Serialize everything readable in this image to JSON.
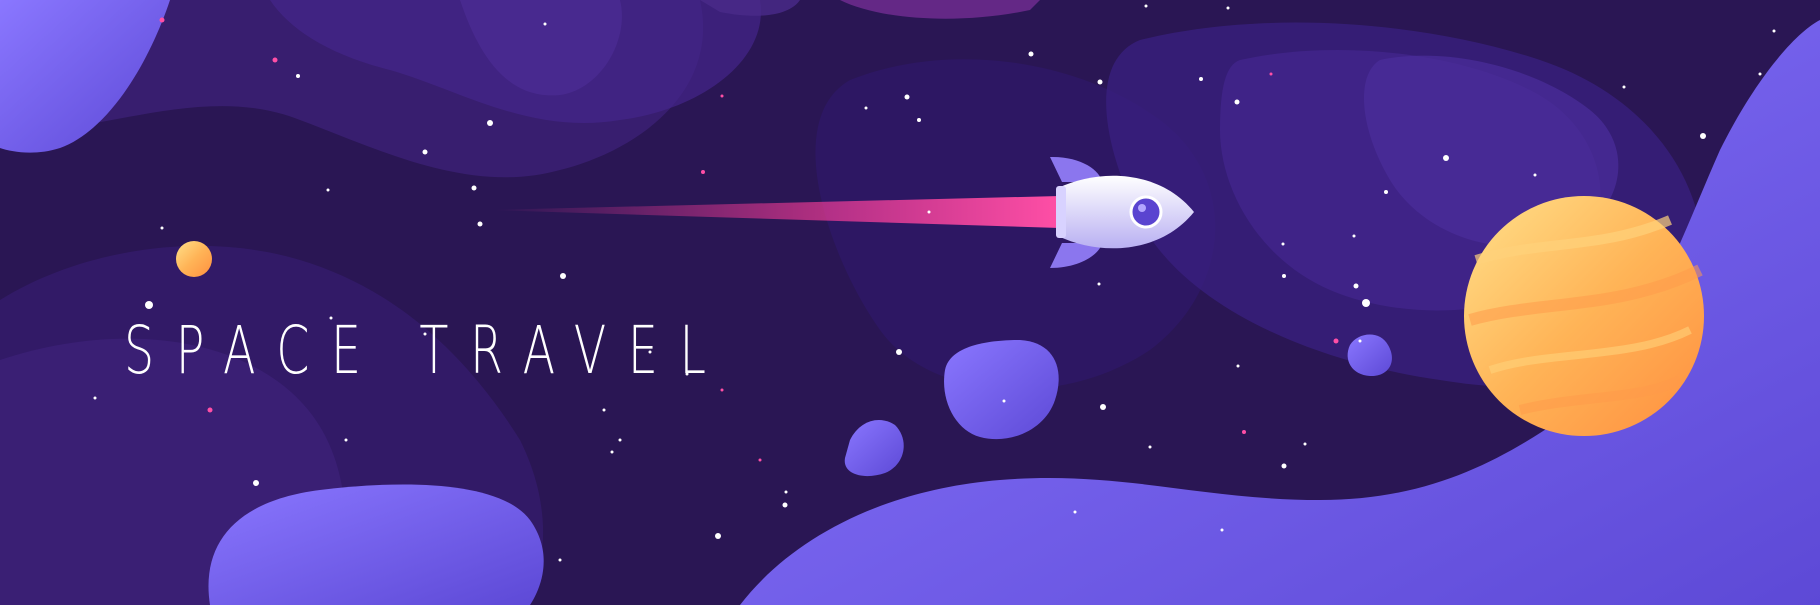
{
  "banner": {
    "title": "SPACE TRAVEL"
  },
  "colors": {
    "background": "#2a1654",
    "nebula_dark": "#231148",
    "nebula_mid": "#3a1f72",
    "foreground_blob": "#7b66f2",
    "planet_orange": "#ffb457",
    "rocket_body": "#e9e5ff",
    "rocket_trail": "#ff3d9a"
  }
}
